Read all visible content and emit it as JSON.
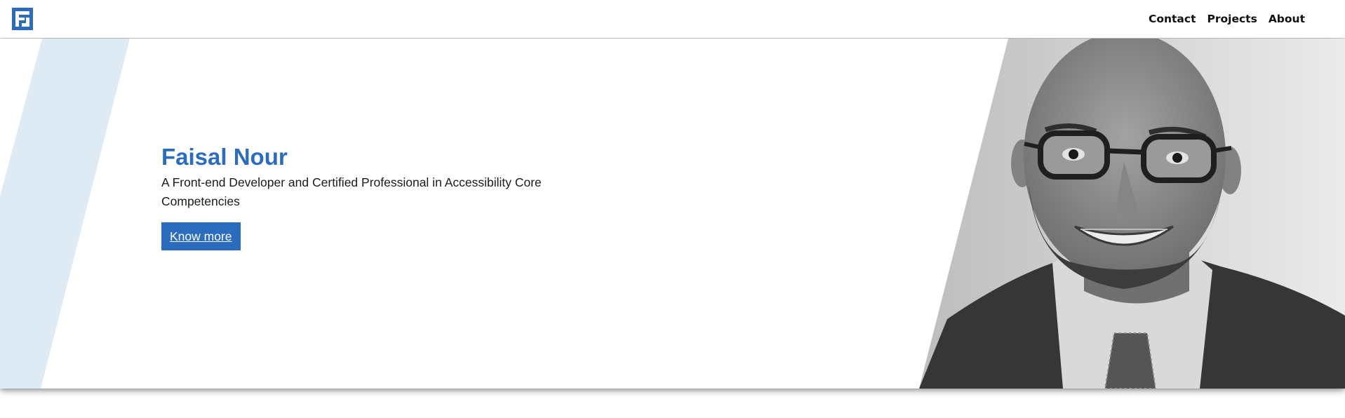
{
  "header": {
    "logo_alt": "FN logo",
    "nav": [
      {
        "label": "Contact"
      },
      {
        "label": "Projects"
      },
      {
        "label": "About"
      }
    ]
  },
  "hero": {
    "title": "Faisal Nour",
    "subtitle": "A Front-end Developer and Certified Professional in Accessibility Core Competencies",
    "cta_label": "Know more",
    "portrait_icon": "portrait-photo"
  },
  "colors": {
    "accent": "#2b6cbf",
    "stripe": "#deebf5",
    "text": "#1a1a1a"
  }
}
